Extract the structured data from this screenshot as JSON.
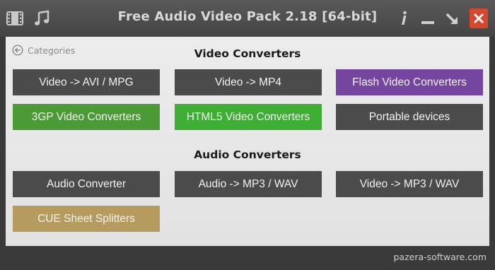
{
  "window": {
    "title": "Free Audio Video Pack 2.18 [64-bit]",
    "icons": [
      "film-icon",
      "music-note-icon",
      "info-icon",
      "minimize-icon",
      "restore-icon",
      "close-icon"
    ]
  },
  "nav": {
    "back_label": "Categories"
  },
  "video": {
    "heading": "Video Converters",
    "tiles": [
      {
        "label": "Video -> AVI / MPG",
        "color": "#4b4b4b"
      },
      {
        "label": "Video -> MP4",
        "color": "#4b4b4b"
      },
      {
        "label": "Flash Video Converters",
        "color": "#7546a0"
      },
      {
        "label": "3GP Video Converters",
        "color": "#4c9a36"
      },
      {
        "label": "HTML5 Video Converters",
        "color": "#3fae34"
      },
      {
        "label": "Portable devices",
        "color": "#4b4b4b"
      }
    ]
  },
  "audio": {
    "heading": "Audio Converters",
    "tiles": [
      {
        "label": "Audio Converter",
        "color": "#4b4b4b"
      },
      {
        "label": "Audio -> MP3 / WAV",
        "color": "#4b4b4b"
      },
      {
        "label": "Video -> MP3 / WAV",
        "color": "#4b4b4b"
      },
      {
        "label": "CUE Sheet Splitters",
        "color": "#b59b5d"
      }
    ]
  },
  "footer": {
    "link": "pazera-software.com"
  }
}
